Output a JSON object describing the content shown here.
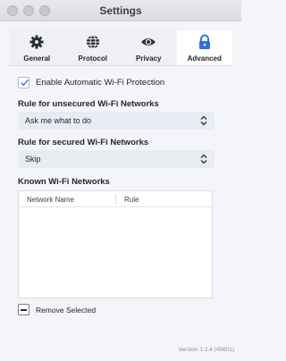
{
  "window": {
    "title": "Settings"
  },
  "tabs": [
    {
      "label": "General",
      "icon": "gear-icon",
      "active": false
    },
    {
      "label": "Protocol",
      "icon": "globe-icon",
      "active": false
    },
    {
      "label": "Privacy",
      "icon": "eye-icon",
      "active": false
    },
    {
      "label": "Advanced",
      "icon": "lock-icon",
      "active": true
    }
  ],
  "auto_protection": {
    "label": "Enable Automatic Wi-Fi Protection",
    "checked": true
  },
  "unsecured": {
    "heading": "Rule for unsecured Wi-Fi Networks",
    "value": "Ask me what to do"
  },
  "secured": {
    "heading": "Rule for secured Wi-Fi Networks",
    "value": "Skip"
  },
  "known": {
    "heading": "Known Wi-Fi Networks",
    "columns": [
      "Network Name",
      "Rule"
    ],
    "rows": []
  },
  "remove_selected": {
    "label": "Remove Selected"
  },
  "version": "Version 1.2.4 (45601)",
  "colors": {
    "accent": "#2f6fe0",
    "check": "#3b78e7"
  }
}
